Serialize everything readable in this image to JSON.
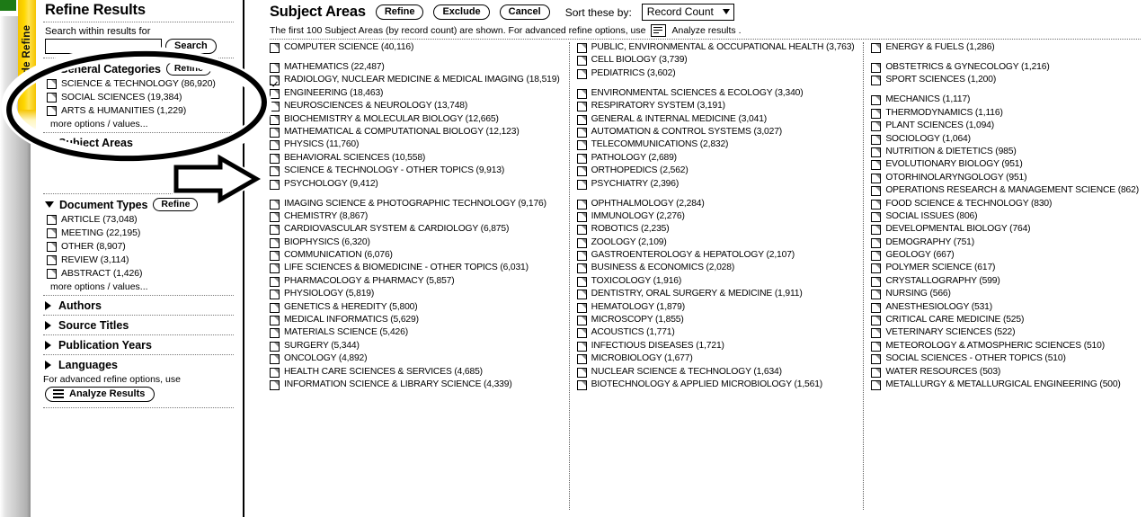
{
  "browser": {
    "hide_refine_tab": "Hide Refine"
  },
  "sidebar": {
    "title": "Refine Results",
    "search_label": "Search within results for",
    "search_value": "",
    "search_placeholder": "",
    "search_button": "Search",
    "general_categories": {
      "heading": "General Categories",
      "refine_button": "Refine",
      "items": [
        {
          "label": "SCIENCE & TECHNOLOGY (86,920)",
          "checked": false
        },
        {
          "label": "SOCIAL SCIENCES (19,384)",
          "checked": false
        },
        {
          "label": "ARTS & HUMANITIES (1,229)",
          "checked": false
        }
      ],
      "more_link": "more options / values..."
    },
    "subject_areas_collapsed": "Subject Areas",
    "document_types": {
      "heading": "Document Types",
      "refine_button": "Refine",
      "items": [
        {
          "label": "ARTICLE (73,048)",
          "checked": false
        },
        {
          "label": "MEETING (22,195)",
          "checked": false
        },
        {
          "label": "OTHER (8,907)",
          "checked": false
        },
        {
          "label": "REVIEW (3,114)",
          "checked": false
        },
        {
          "label": "ABSTRACT (1,426)",
          "checked": false
        }
      ],
      "more_link": "more options / values..."
    },
    "collapsed_groups": [
      {
        "label": "Authors"
      },
      {
        "label": "Source Titles"
      },
      {
        "label": "Publication Years"
      },
      {
        "label": "Languages"
      }
    ],
    "advanced_note": "For advanced refine options, use",
    "analyze_button": "Analyze Results"
  },
  "main": {
    "title": "Subject Areas",
    "refine_button": "Refine",
    "exclude_button": "Exclude",
    "cancel_button": "Cancel",
    "sort_label": "Sort these by:",
    "sort_value": "Record Count",
    "note_prefix": "The first 100 Subject Areas (by record count) are shown. For advanced refine options, use",
    "note_suffix": "Analyze results .",
    "columns": [
      {
        "items": [
          {
            "label": "COMPUTER SCIENCE (40,116)",
            "checked": false,
            "gap_after": true
          },
          {
            "label": "MATHEMATICS (22,487)",
            "checked": false
          },
          {
            "label": "RADIOLOGY, NUCLEAR MEDICINE & MEDICAL IMAGING (18,519)",
            "checked": true
          },
          {
            "label": "ENGINEERING (18,463)",
            "checked": false
          },
          {
            "label": "NEUROSCIENCES & NEUROLOGY (13,748)",
            "checked": false
          },
          {
            "label": "BIOCHEMISTRY & MOLECULAR BIOLOGY (12,665)",
            "checked": false
          },
          {
            "label": "MATHEMATICAL & COMPUTATIONAL BIOLOGY (12,123)",
            "checked": false
          },
          {
            "label": "PHYSICS (11,760)",
            "checked": false
          },
          {
            "label": "BEHAVIORAL SCIENCES (10,558)",
            "checked": false
          },
          {
            "label": "SCIENCE & TECHNOLOGY - OTHER TOPICS (9,913)",
            "checked": false
          },
          {
            "label": "PSYCHOLOGY (9,412)",
            "checked": false,
            "gap_after": true
          },
          {
            "label": "IMAGING SCIENCE & PHOTOGRAPHIC TECHNOLOGY (9,176)",
            "checked": false
          },
          {
            "label": "CHEMISTRY (8,867)",
            "checked": false
          },
          {
            "label": "CARDIOVASCULAR SYSTEM & CARDIOLOGY (6,875)",
            "checked": false
          },
          {
            "label": "BIOPHYSICS (6,320)",
            "checked": false
          },
          {
            "label": "COMMUNICATION (6,076)",
            "checked": false
          },
          {
            "label": "LIFE SCIENCES & BIOMEDICINE - OTHER TOPICS (6,031)",
            "checked": false
          },
          {
            "label": "PHARMACOLOGY & PHARMACY (5,857)",
            "checked": false
          },
          {
            "label": "PHYSIOLOGY (5,819)",
            "checked": false
          },
          {
            "label": "GENETICS & HEREDITY (5,800)",
            "checked": false
          },
          {
            "label": "MEDICAL INFORMATICS (5,629)",
            "checked": false
          },
          {
            "label": "MATERIALS SCIENCE (5,426)",
            "checked": false
          },
          {
            "label": "SURGERY (5,344)",
            "checked": false
          },
          {
            "label": "ONCOLOGY (4,892)",
            "checked": false
          },
          {
            "label": "HEALTH CARE SCIENCES & SERVICES (4,685)",
            "checked": false
          },
          {
            "label": "INFORMATION SCIENCE & LIBRARY SCIENCE (4,339)",
            "checked": false
          }
        ]
      },
      {
        "items": [
          {
            "label": "PUBLIC, ENVIRONMENTAL & OCCUPATIONAL HEALTH (3,763)",
            "checked": false
          },
          {
            "label": "CELL BIOLOGY (3,739)",
            "checked": false
          },
          {
            "label": "PEDIATRICS (3,602)",
            "checked": false,
            "gap_after": true
          },
          {
            "label": "ENVIRONMENTAL SCIENCES & ECOLOGY (3,340)",
            "checked": false
          },
          {
            "label": "RESPIRATORY SYSTEM (3,191)",
            "checked": false
          },
          {
            "label": "GENERAL & INTERNAL MEDICINE (3,041)",
            "checked": false
          },
          {
            "label": "AUTOMATION & CONTROL SYSTEMS (3,027)",
            "checked": false
          },
          {
            "label": "TELECOMMUNICATIONS (2,832)",
            "checked": false
          },
          {
            "label": "PATHOLOGY (2,689)",
            "checked": false
          },
          {
            "label": "ORTHOPEDICS (2,562)",
            "checked": false
          },
          {
            "label": "PSYCHIATRY (2,396)",
            "checked": false,
            "gap_after": true
          },
          {
            "label": "OPHTHALMOLOGY (2,284)",
            "checked": false
          },
          {
            "label": "IMMUNOLOGY (2,276)",
            "checked": false
          },
          {
            "label": "ROBOTICS (2,235)",
            "checked": false
          },
          {
            "label": "ZOOLOGY (2,109)",
            "checked": false
          },
          {
            "label": "GASTROENTEROLOGY & HEPATOLOGY (2,107)",
            "checked": false
          },
          {
            "label": "BUSINESS & ECONOMICS (2,028)",
            "checked": false
          },
          {
            "label": "TOXICOLOGY (1,916)",
            "checked": false
          },
          {
            "label": "DENTISTRY, ORAL SURGERY & MEDICINE (1,911)",
            "checked": false
          },
          {
            "label": "HEMATOLOGY (1,879)",
            "checked": false
          },
          {
            "label": "MICROSCOPY (1,855)",
            "checked": false
          },
          {
            "label": "ACOUSTICS (1,771)",
            "checked": false
          },
          {
            "label": "INFECTIOUS DISEASES (1,721)",
            "checked": false
          },
          {
            "label": "MICROBIOLOGY (1,677)",
            "checked": false
          },
          {
            "label": "NUCLEAR SCIENCE & TECHNOLOGY (1,634)",
            "checked": false
          },
          {
            "label": "BIOTECHNOLOGY & APPLIED MICROBIOLOGY (1,561)",
            "checked": false
          }
        ]
      },
      {
        "items": [
          {
            "label": "ENERGY & FUELS (1,286)",
            "checked": false,
            "gap_after": true
          },
          {
            "label": "OBSTETRICS & GYNECOLOGY (1,216)",
            "checked": false
          },
          {
            "label": "SPORT SCIENCES (1,200)",
            "checked": false,
            "gap_after": true
          },
          {
            "label": "MECHANICS (1,117)",
            "checked": false
          },
          {
            "label": "THERMODYNAMICS (1,116)",
            "checked": false
          },
          {
            "label": "PLANT SCIENCES (1,094)",
            "checked": false
          },
          {
            "label": "SOCIOLOGY (1,064)",
            "checked": false
          },
          {
            "label": "NUTRITION & DIETETICS (985)",
            "checked": false
          },
          {
            "label": "EVOLUTIONARY BIOLOGY (951)",
            "checked": false
          },
          {
            "label": "OTORHINOLARYNGOLOGY (951)",
            "checked": false
          },
          {
            "label": "OPERATIONS RESEARCH & MANAGEMENT SCIENCE (862)",
            "checked": false
          },
          {
            "label": "FOOD SCIENCE & TECHNOLOGY (830)",
            "checked": false
          },
          {
            "label": "SOCIAL ISSUES (806)",
            "checked": false
          },
          {
            "label": "DEVELOPMENTAL BIOLOGY (764)",
            "checked": false
          },
          {
            "label": "DEMOGRAPHY (751)",
            "checked": false
          },
          {
            "label": "GEOLOGY (667)",
            "checked": false
          },
          {
            "label": "POLYMER SCIENCE (617)",
            "checked": false
          },
          {
            "label": "CRYSTALLOGRAPHY (599)",
            "checked": false
          },
          {
            "label": "NURSING (566)",
            "checked": false
          },
          {
            "label": "ANESTHESIOLOGY (531)",
            "checked": false
          },
          {
            "label": "CRITICAL CARE MEDICINE (525)",
            "checked": false
          },
          {
            "label": "VETERINARY SCIENCES (522)",
            "checked": false
          },
          {
            "label": "METEOROLOGY & ATMOSPHERIC SCIENCES (510)",
            "checked": false
          },
          {
            "label": "SOCIAL SCIENCES - OTHER TOPICS (510)",
            "checked": false
          },
          {
            "label": "WATER RESOURCES (503)",
            "checked": false
          },
          {
            "label": "METALLURGY & METALLURGICAL ENGINEERING (500)",
            "checked": false
          }
        ]
      }
    ]
  },
  "annotations": {
    "ellipse_target": "General Categories",
    "arrow_target": "Subject Areas"
  },
  "colors": {
    "tab_yellow": "#ffd700",
    "chrome_gray": "#c9c9c9",
    "text": "#000000",
    "smudge_green": "#e1eddb"
  }
}
